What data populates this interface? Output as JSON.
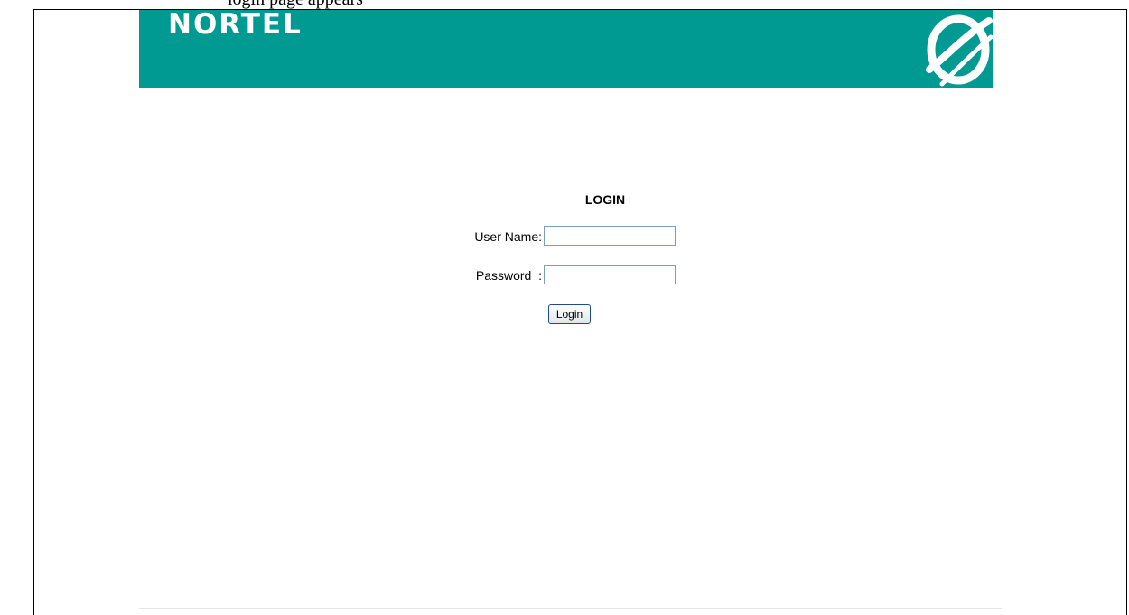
{
  "document": {
    "caption_fragment": "login page appears"
  },
  "header": {
    "brand": "NORTEL",
    "logo_icon": "nortel-globe-icon",
    "background_color": "#009a93"
  },
  "login": {
    "title": "LOGIN",
    "username_label": "User Name:",
    "username_value": "",
    "password_label": "Password  :",
    "password_value": "",
    "submit_label": "Login"
  }
}
